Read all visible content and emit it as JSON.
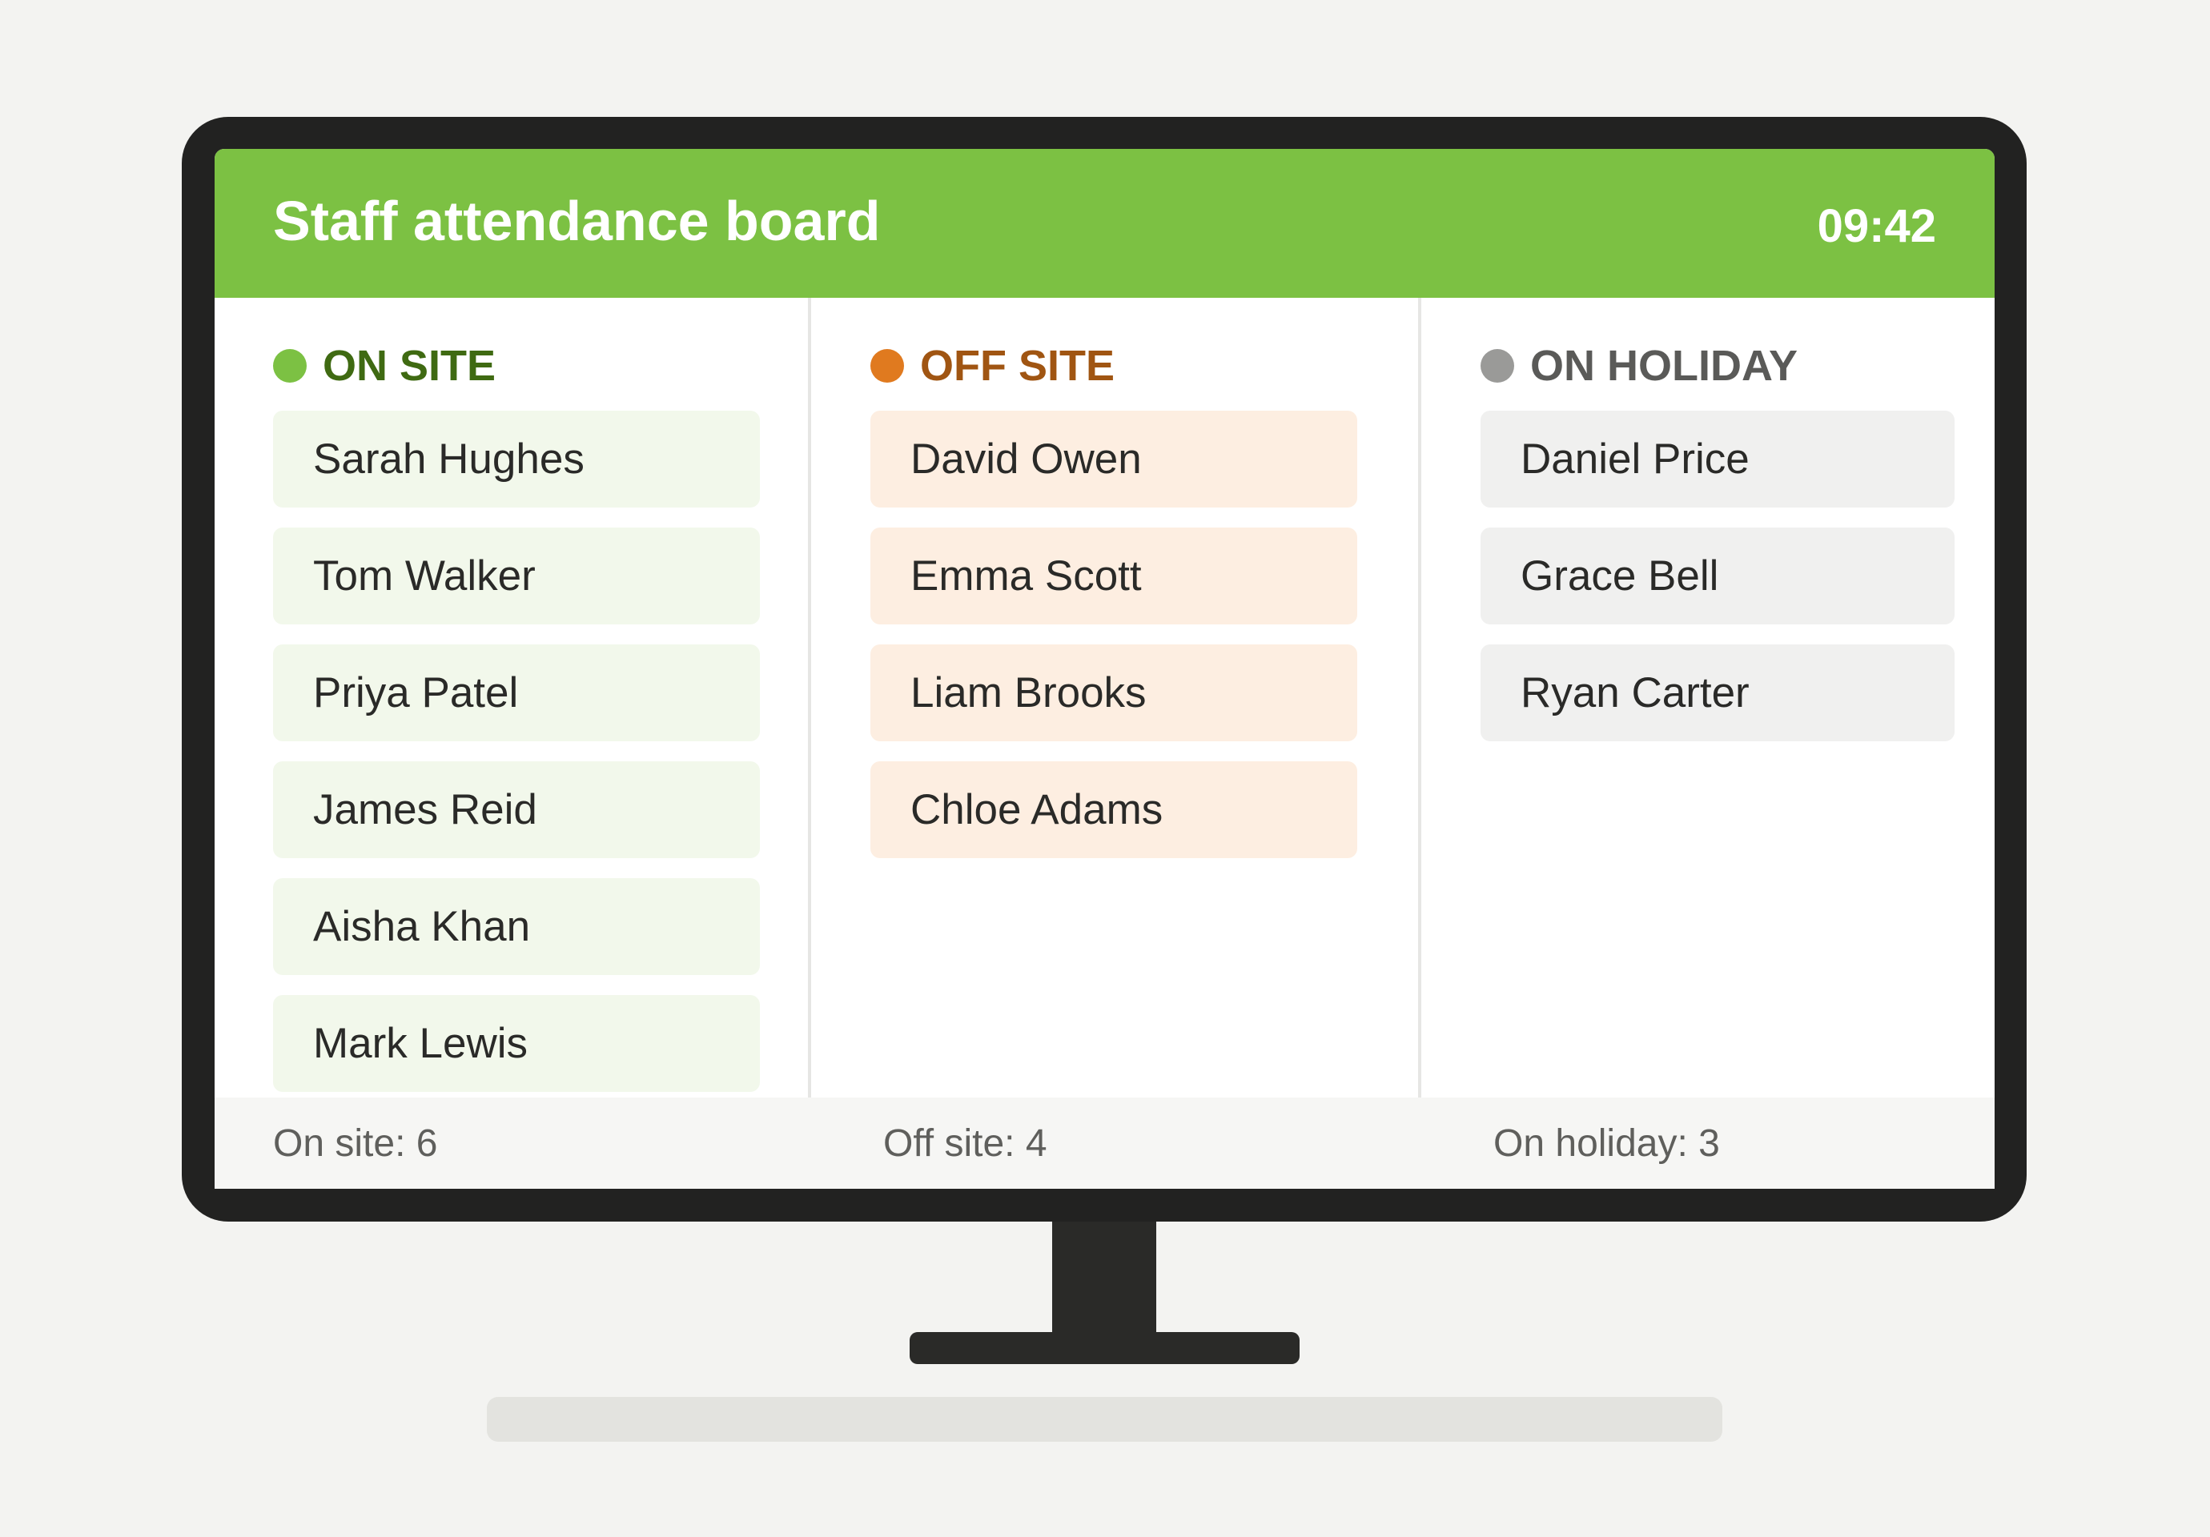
{
  "header": {
    "title": "Staff attendance board",
    "time": "09:42"
  },
  "colors": {
    "header_bg": "#7cc143",
    "on_site": "#7cc143",
    "on_site_text": "#3f6a12",
    "off_site": "#e07a1f",
    "off_site_text": "#a05512",
    "on_holiday": "#9a9a98",
    "on_holiday_text": "#5a5a58"
  },
  "columns": [
    {
      "label": "ON SITE",
      "names": [
        "Sarah Hughes",
        "Tom Walker",
        "Priya Patel",
        "James Reid",
        "Aisha Khan",
        "Mark Lewis"
      ]
    },
    {
      "label": "OFF SITE",
      "names": [
        "David Owen",
        "Emma Scott",
        "Liam Brooks",
        "Chloe Adams"
      ]
    },
    {
      "label": "ON HOLIDAY",
      "names": [
        "Daniel Price",
        "Grace Bell",
        "Ryan Carter"
      ]
    }
  ],
  "footer": {
    "on_site": "On site: 6",
    "off_site": "Off site: 4",
    "on_holiday": "On holiday: 3"
  }
}
